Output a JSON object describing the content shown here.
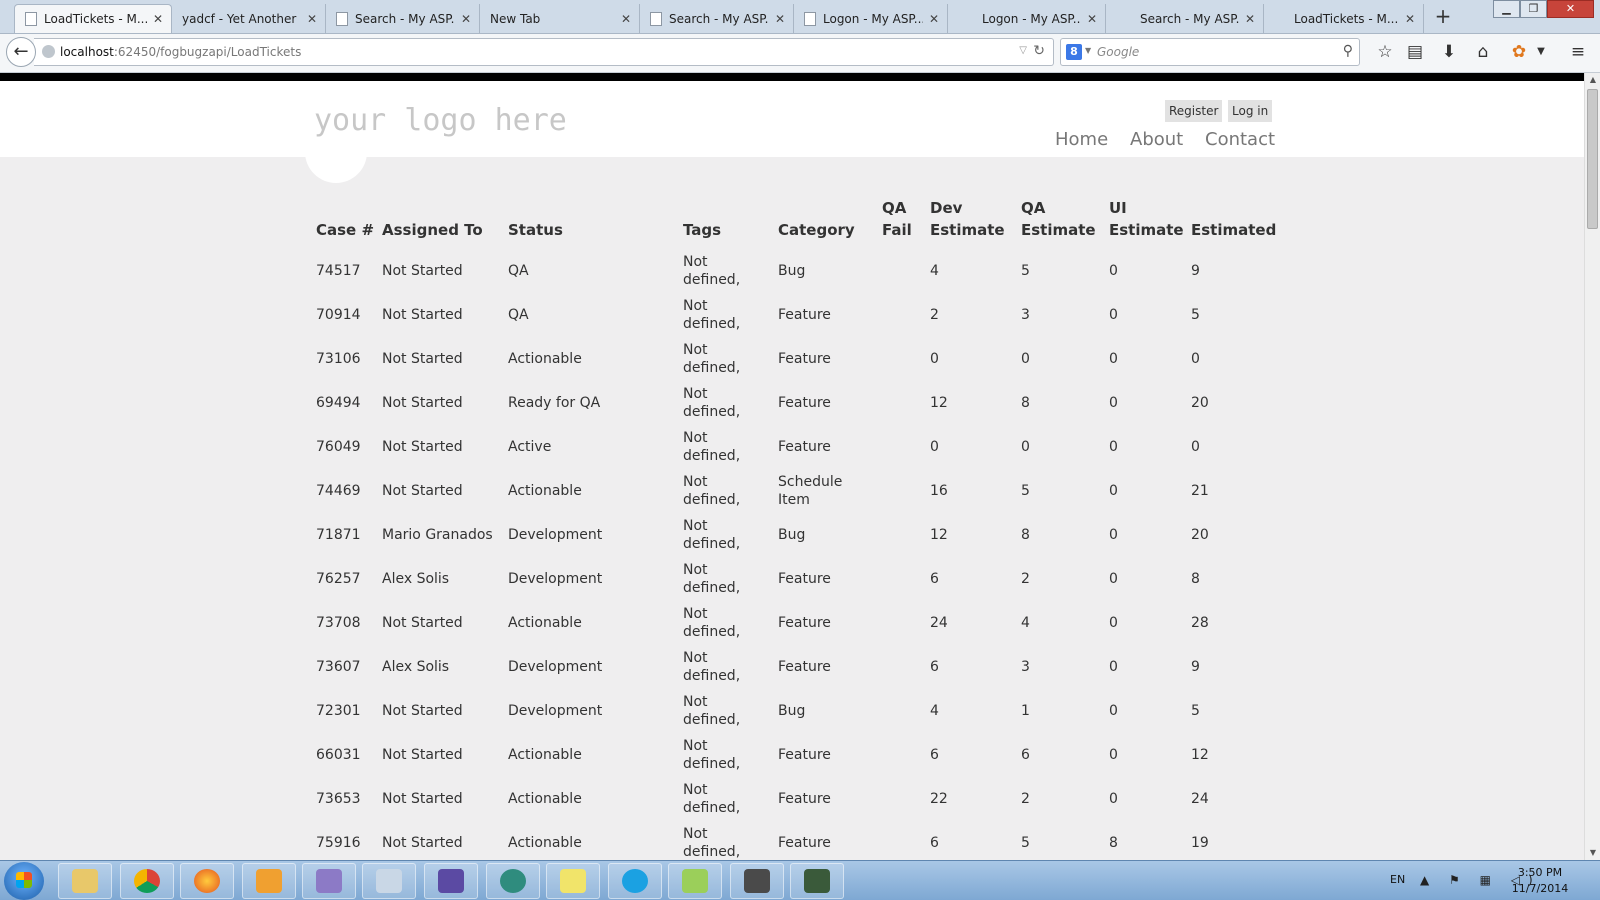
{
  "browser": {
    "tabs": [
      {
        "label": "LoadTickets - M...",
        "active": true
      },
      {
        "label": "yadcf - Yet Another ..."
      },
      {
        "label": "Search - My ASP...."
      },
      {
        "label": "New Tab"
      },
      {
        "label": "Search - My ASP...."
      },
      {
        "label": "Logon - My ASP...."
      },
      {
        "label": "Logon - My ASP...."
      },
      {
        "label": "Search - My ASP...."
      },
      {
        "label": "LoadTickets - M..."
      }
    ],
    "url_host": "localhost",
    "url_rest": ":62450/fogbugzapi/LoadTickets",
    "search_placeholder": "Google",
    "search_engine_letter": "8"
  },
  "site": {
    "logo": "your logo here",
    "register": "Register",
    "login": "Log in",
    "nav": [
      "Home",
      "About",
      "Contact"
    ]
  },
  "table": {
    "headers": {
      "case": "Case #",
      "assigned": "Assigned To",
      "status": "Status",
      "tags": "Tags",
      "category": "Category",
      "qa_fail_1": "QA",
      "qa_fail_2": "Fail",
      "dev_est_1": "Dev",
      "dev_est_2": "Estimate",
      "qa_est_1": "QA",
      "qa_est_2": "Estimate",
      "ui_est_1": "UI",
      "ui_est_2": "Estimate",
      "estimated": "Estimated"
    },
    "rows": [
      {
        "case": "74517",
        "assigned": "Not Started",
        "status": "QA",
        "tags_1": "Not",
        "tags_2": "defined,",
        "category_1": "Bug",
        "category_2": "",
        "qa_fail": "",
        "dev": "4",
        "qa": "5",
        "ui": "0",
        "est": "9"
      },
      {
        "case": "70914",
        "assigned": "Not Started",
        "status": "QA",
        "tags_1": "Not",
        "tags_2": "defined,",
        "category_1": "Feature",
        "category_2": "",
        "qa_fail": "",
        "dev": "2",
        "qa": "3",
        "ui": "0",
        "est": "5"
      },
      {
        "case": "73106",
        "assigned": "Not Started",
        "status": "Actionable",
        "tags_1": "Not",
        "tags_2": "defined,",
        "category_1": "Feature",
        "category_2": "",
        "qa_fail": "",
        "dev": "0",
        "qa": "0",
        "ui": "0",
        "est": "0"
      },
      {
        "case": "69494",
        "assigned": "Not Started",
        "status": "Ready for QA",
        "tags_1": "Not",
        "tags_2": "defined,",
        "category_1": "Feature",
        "category_2": "",
        "qa_fail": "",
        "dev": "12",
        "qa": "8",
        "ui": "0",
        "est": "20"
      },
      {
        "case": "76049",
        "assigned": "Not Started",
        "status": "Active",
        "tags_1": "Not",
        "tags_2": "defined,",
        "category_1": "Feature",
        "category_2": "",
        "qa_fail": "",
        "dev": "0",
        "qa": "0",
        "ui": "0",
        "est": "0"
      },
      {
        "case": "74469",
        "assigned": "Not Started",
        "status": "Actionable",
        "tags_1": "Not",
        "tags_2": "defined,",
        "category_1": "Schedule",
        "category_2": "Item",
        "qa_fail": "",
        "dev": "16",
        "qa": "5",
        "ui": "0",
        "est": "21"
      },
      {
        "case": "71871",
        "assigned": "Mario Granados",
        "status": "Development",
        "tags_1": "Not",
        "tags_2": "defined,",
        "category_1": "Bug",
        "category_2": "",
        "qa_fail": "",
        "dev": "12",
        "qa": "8",
        "ui": "0",
        "est": "20"
      },
      {
        "case": "76257",
        "assigned": "Alex Solis",
        "status": "Development",
        "tags_1": "Not",
        "tags_2": "defined,",
        "category_1": "Feature",
        "category_2": "",
        "qa_fail": "",
        "dev": "6",
        "qa": "2",
        "ui": "0",
        "est": "8"
      },
      {
        "case": "73708",
        "assigned": "Not Started",
        "status": "Actionable",
        "tags_1": "Not",
        "tags_2": "defined,",
        "category_1": "Feature",
        "category_2": "",
        "qa_fail": "",
        "dev": "24",
        "qa": "4",
        "ui": "0",
        "est": "28"
      },
      {
        "case": "73607",
        "assigned": "Alex Solis",
        "status": "Development",
        "tags_1": "Not",
        "tags_2": "defined,",
        "category_1": "Feature",
        "category_2": "",
        "qa_fail": "",
        "dev": "6",
        "qa": "3",
        "ui": "0",
        "est": "9"
      },
      {
        "case": "72301",
        "assigned": "Not Started",
        "status": "Development",
        "tags_1": "Not",
        "tags_2": "defined,",
        "category_1": "Bug",
        "category_2": "",
        "qa_fail": "",
        "dev": "4",
        "qa": "1",
        "ui": "0",
        "est": "5"
      },
      {
        "case": "66031",
        "assigned": "Not Started",
        "status": "Actionable",
        "tags_1": "Not",
        "tags_2": "defined,",
        "category_1": "Feature",
        "category_2": "",
        "qa_fail": "",
        "dev": "6",
        "qa": "6",
        "ui": "0",
        "est": "12"
      },
      {
        "case": "73653",
        "assigned": "Not Started",
        "status": "Actionable",
        "tags_1": "Not",
        "tags_2": "defined,",
        "category_1": "Feature",
        "category_2": "",
        "qa_fail": "",
        "dev": "22",
        "qa": "2",
        "ui": "0",
        "est": "24"
      },
      {
        "case": "75916",
        "assigned": "Not Started",
        "status": "Actionable",
        "tags_1": "Not",
        "tags_2": "defined,",
        "category_1": "Feature",
        "category_2": "",
        "qa_fail": "",
        "dev": "6",
        "qa": "5",
        "ui": "8",
        "est": "19"
      }
    ]
  },
  "taskbar": {
    "apps": [
      "explorer-icon",
      "chrome-icon",
      "firefox-icon",
      "outlook-icon",
      "messenger-icon",
      "paint-icon",
      "visual-studio-icon",
      "globe-sync-icon",
      "sticky-notes-icon",
      "skype-icon",
      "notepad-icon",
      "sublime-icon",
      "terminal-icon"
    ],
    "language": "EN",
    "time": "3:50 PM",
    "date": "11/7/2014"
  },
  "colors": {
    "page_bg": "#efeeef",
    "header_bg": "#ffffff",
    "logo": "#c7c7c7",
    "nav": "#777777",
    "text": "#333333"
  }
}
